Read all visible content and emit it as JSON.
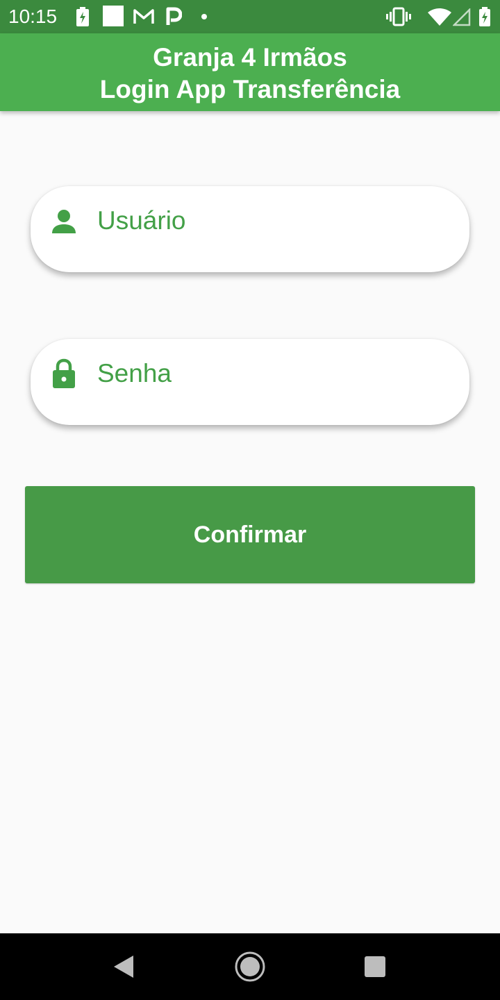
{
  "status_bar": {
    "time": "10:15",
    "icons": [
      "battery-saver-icon",
      "square-notification-icon",
      "gmail-icon",
      "parking-icon",
      "dot-icon",
      "vibrate-icon",
      "wifi-icon",
      "no-signal-icon",
      "battery-charging-icon"
    ]
  },
  "app_bar": {
    "title_line1": "Granja 4 Irmãos",
    "title_line2": "Login App Transferência",
    "color": "#4caf50"
  },
  "form": {
    "username": {
      "placeholder": "Usuário",
      "value": "",
      "icon": "person-icon"
    },
    "password": {
      "placeholder": "Senha",
      "value": "",
      "icon": "lock-icon"
    },
    "confirm_label": "Confirmar"
  },
  "nav_bar": {
    "buttons": [
      "back-icon",
      "home-icon",
      "recents-icon"
    ]
  },
  "colors": {
    "status_bar": "#3b8a3e",
    "accent": "#43a047",
    "button": "#479a47",
    "background": "#fafafa"
  }
}
